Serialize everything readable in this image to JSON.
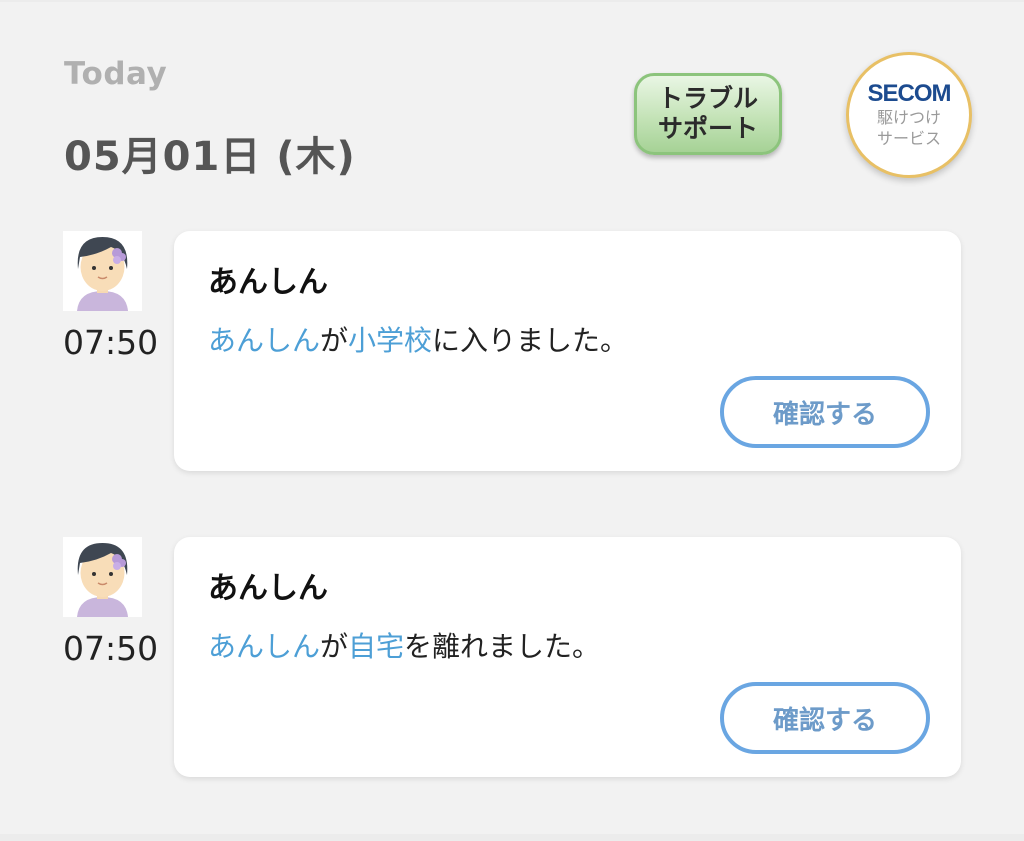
{
  "header": {
    "today_label": "Today",
    "date": "05月01日 (木)"
  },
  "trouble_support": {
    "line1": "トラブル",
    "line2": "サポート"
  },
  "secom": {
    "logo": "SECOM",
    "line1": "駆けつけ",
    "line2": "サービス"
  },
  "colors": {
    "accent_blue": "#4d9fd6",
    "button_border": "#6aa6e2",
    "trouble_green": "#a6d296",
    "secom_gold": "#e8c065"
  },
  "notifications": [
    {
      "avatar": "child-avatar-icon",
      "time": "07:50",
      "title": "あんしん",
      "name_part": "あんしん",
      "particle": "が",
      "place": "小学校",
      "action": "に入りました。",
      "confirm_label": "確認する"
    },
    {
      "avatar": "child-avatar-icon",
      "time": "07:50",
      "title": "あんしん",
      "name_part": "あんしん",
      "particle": "が",
      "place": "自宅",
      "action": "を離れました。",
      "confirm_label": "確認する"
    }
  ]
}
